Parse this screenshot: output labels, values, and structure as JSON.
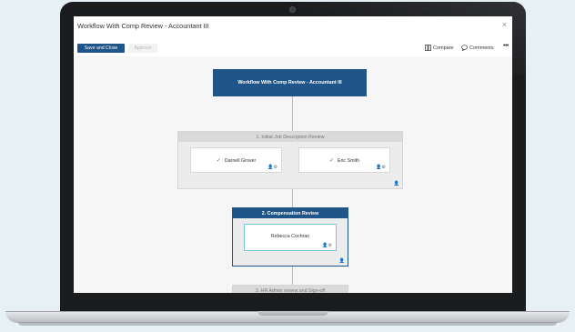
{
  "window": {
    "title": "Workflow With Comp Review - Accountant III",
    "close_glyph": "×"
  },
  "toolbar": {
    "save_close": "Save and Close",
    "approve": "Approve",
    "compare": "Compare",
    "comments": "Comments",
    "more": "•••"
  },
  "workflow": {
    "header": "Workflow With Comp Review - Accountant III",
    "stages": [
      {
        "label": "1. Initial Job Description Review",
        "reviewers": [
          "Darnell Grover",
          "Eric Smith"
        ],
        "state": "completed"
      },
      {
        "label": "2. Compensation Review",
        "reviewers": [
          "Rebecca Cochran"
        ],
        "state": "active"
      },
      {
        "label": "3. HR Admin review and Sign-off",
        "reviewers": [],
        "state": "pending"
      }
    ]
  },
  "icons": {
    "check": "✓",
    "compare": "compare-icon",
    "comments": "comment-icon",
    "person_add": "person-add-icon"
  },
  "colors": {
    "primary": "#1f5588",
    "active_border": "#74c6e0",
    "check": "#3b8a3e"
  }
}
